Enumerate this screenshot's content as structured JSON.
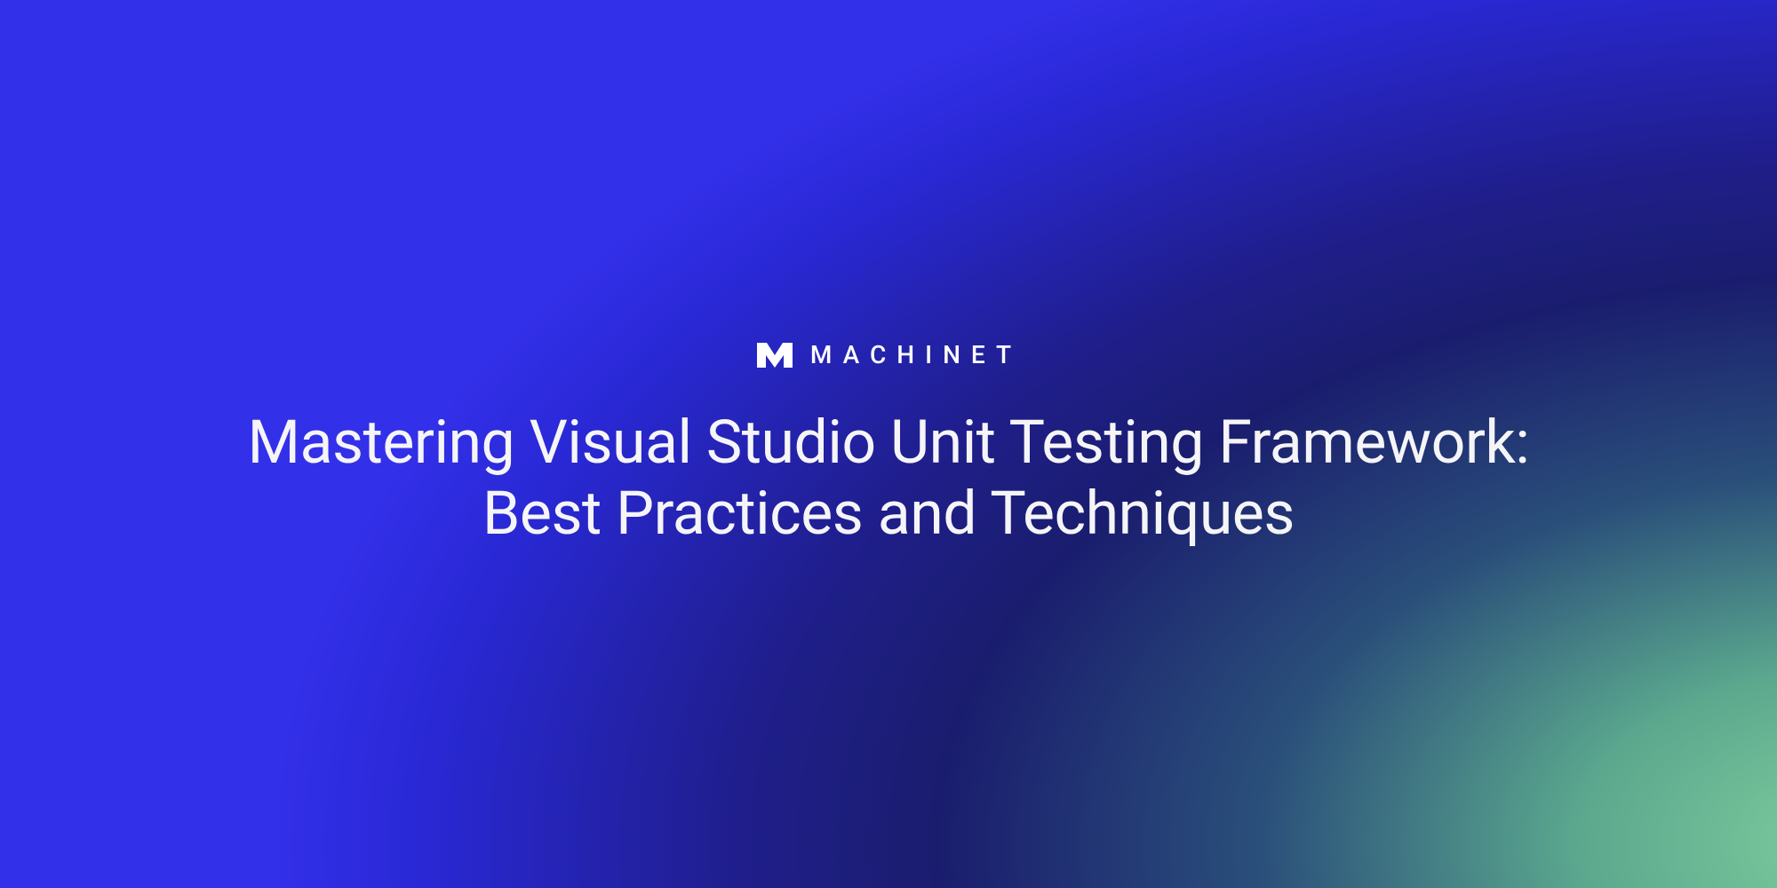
{
  "brand": {
    "name": "MACHINET"
  },
  "headline": "Mastering Visual Studio Unit Testing Framework: Best Practices and Techniques"
}
